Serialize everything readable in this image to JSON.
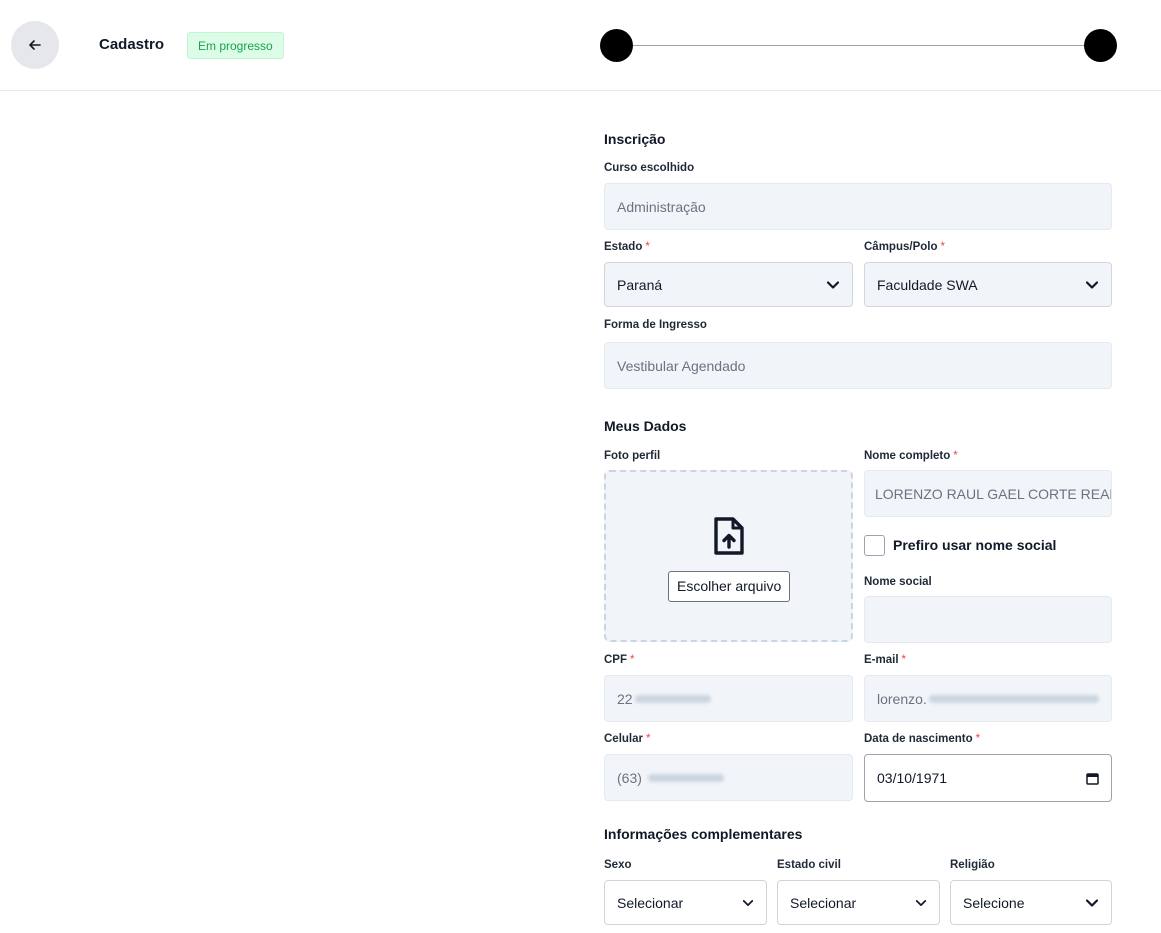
{
  "header": {
    "back_icon": "arrow-left-icon",
    "title": "Cadastro",
    "status_badge": "Em progresso"
  },
  "inscricao": {
    "section_title": "Inscrição",
    "curso_label": "Curso escolhido",
    "curso_value": "Administração",
    "estado_label": "Estado",
    "estado_value": "Paraná",
    "campus_label": "Câmpus/Polo",
    "campus_value": "Faculdade SWA",
    "forma_label": "Forma de Ingresso",
    "forma_value": "Vestibular Agendado",
    "required_mark": "*"
  },
  "meus_dados": {
    "section_title": "Meus Dados",
    "foto_label": "Foto perfil",
    "upload_icon": "file-upload-icon",
    "choose_file_label": "Escolher arquivo",
    "nome_label": "Nome completo",
    "nome_value": "LORENZO RAUL GAEL CORTE REAL",
    "social_checkbox_label": "Prefiro usar nome social",
    "nome_social_label": "Nome social",
    "nome_social_value": "",
    "cpf_label": "CPF",
    "cpf_value_visible": "22",
    "email_label": "E-mail",
    "email_value_visible": "lorenzo.",
    "celular_label": "Celular",
    "celular_value_visible": "(63)",
    "nascimento_label": "Data de nascimento",
    "nascimento_value": "03/10/1971"
  },
  "complementares": {
    "section_title": "Informações complementares",
    "sexo_label": "Sexo",
    "sexo_value": "Selecionar",
    "estado_civil_label": "Estado civil",
    "estado_civil_value": "Selecionar",
    "religiao_label": "Religião",
    "religiao_value": "Selecione"
  },
  "colors": {
    "badge_text": "#16a34a",
    "badge_bg": "#dcfce7",
    "required": "#ef4444",
    "field_bg": "#f1f5f9"
  }
}
